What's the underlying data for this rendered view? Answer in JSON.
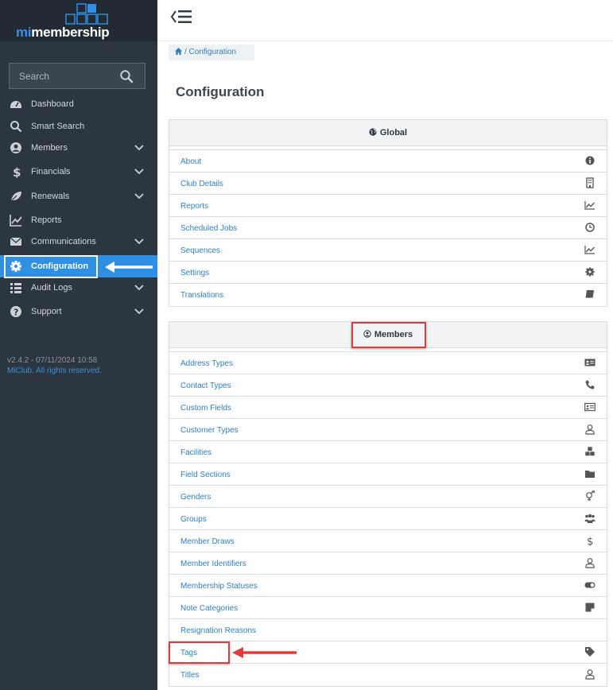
{
  "app": {
    "logo_prefix": "mi",
    "logo_suffix": "membership"
  },
  "search": {
    "placeholder": "Search"
  },
  "sidebar": {
    "items": [
      {
        "label": "Dashboard",
        "icon": "dashboard-icon"
      },
      {
        "label": "Smart Search",
        "icon": "search-icon"
      },
      {
        "label": "Members",
        "icon": "user-circle-icon",
        "expandable": true
      },
      {
        "label": "Financials",
        "icon": "dollar-icon",
        "expandable": true
      },
      {
        "label": "Renewals",
        "icon": "leaf-icon",
        "expandable": true
      },
      {
        "label": "Reports",
        "icon": "line-chart-icon"
      },
      {
        "label": "Communications",
        "icon": "envelope-icon",
        "expandable": true
      },
      {
        "label": "Configuration",
        "icon": "gear-icon",
        "active": true
      },
      {
        "label": "Audit Logs",
        "icon": "list-icon",
        "expandable": true
      },
      {
        "label": "Support",
        "icon": "question-icon",
        "expandable": true
      }
    ],
    "version": "v2.4.2 - 07/11/2024 10:58",
    "copyright": "MiClub. All rights reserved."
  },
  "breadcrumb": {
    "current": "/ Configuration"
  },
  "page": {
    "title": "Configuration"
  },
  "global": {
    "title": "Global",
    "items": [
      {
        "label": "About",
        "icon": "info-circle-icon"
      },
      {
        "label": "Club Details",
        "icon": "building-icon"
      },
      {
        "label": "Reports",
        "icon": "line-chart-icon"
      },
      {
        "label": "Scheduled Jobs",
        "icon": "clock-icon"
      },
      {
        "label": "Sequences",
        "icon": "line-chart-icon"
      },
      {
        "label": "Settings",
        "icon": "gear-icon"
      },
      {
        "label": "Translations",
        "icon": "book-icon"
      }
    ]
  },
  "members": {
    "title": "Members",
    "items": [
      {
        "label": "Address Types",
        "icon": "address-card-icon"
      },
      {
        "label": "Contact Types",
        "icon": "phone-icon"
      },
      {
        "label": "Custom Fields",
        "icon": "id-card-icon"
      },
      {
        "label": "Customer Types",
        "icon": "user-outline-icon"
      },
      {
        "label": "Facilities",
        "icon": "cubes-icon"
      },
      {
        "label": "Field Sections",
        "icon": "folder-icon"
      },
      {
        "label": "Genders",
        "icon": "venus-mars-icon"
      },
      {
        "label": "Groups",
        "icon": "users-icon"
      },
      {
        "label": "Member Draws",
        "icon": "dollar-icon"
      },
      {
        "label": "Member Identifiers",
        "icon": "user-outline-icon"
      },
      {
        "label": "Membership Statuses",
        "icon": "toggle-icon"
      },
      {
        "label": "Note Categories",
        "icon": "sticky-note-icon"
      },
      {
        "label": "Resignation Reasons",
        "icon": ""
      },
      {
        "label": "Tags",
        "icon": "tag-icon"
      },
      {
        "label": "Titles",
        "icon": "user-outline-icon"
      }
    ]
  },
  "colors": {
    "sidebar_bg": "#2b3641",
    "accent": "#2f8fe3",
    "link": "#2f7fc1",
    "highlight": "#e23b3b"
  }
}
